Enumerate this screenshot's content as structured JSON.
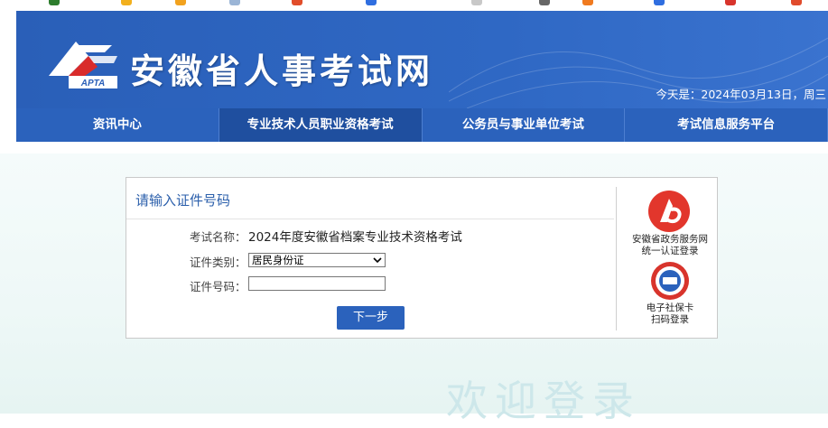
{
  "header": {
    "site_title": "安徽省人事考试网",
    "logo_text": "APTA",
    "date_text": "今天是：2024年03月13日，周三"
  },
  "nav": {
    "items": [
      {
        "label": "资讯中心"
      },
      {
        "label": "专业技术人员职业资格考试"
      },
      {
        "label": "公务员与事业单位考试"
      },
      {
        "label": "考试信息服务平台"
      }
    ]
  },
  "panel": {
    "title": "请输入证件号码",
    "exam_name_label": "考试名称：",
    "exam_name_value": "2024年度安徽省档案专业技术资格考试",
    "id_type_label": "证件类别：",
    "id_type_value": "居民身份证",
    "id_number_label": "证件号码：",
    "id_number_value": "",
    "next_button": "下一步"
  },
  "side": {
    "gov_login_line1": "安徽省政务服务网",
    "gov_login_line2": "统一认证登录",
    "social_card_line1": "电子社保卡",
    "social_card_line2": "扫码登录"
  },
  "background": {
    "welcome_text": "欢迎登录"
  },
  "colors": {
    "header_blue": "#2f68c4",
    "nav_active": "#1f4f9f",
    "button_blue": "#2b62bc",
    "title_blue": "#2b5fab"
  }
}
